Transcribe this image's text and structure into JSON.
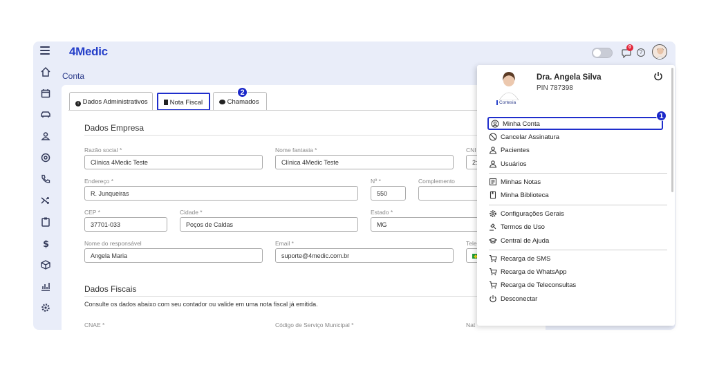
{
  "app": {
    "logo": "4Medic",
    "page_title": "Conta",
    "notification_count": "0"
  },
  "tabs": [
    {
      "label": "Dados Administrativos",
      "icon": "info-circle-icon"
    },
    {
      "label": "Nota Fiscal",
      "icon": "document-icon"
    },
    {
      "label": "Chamados",
      "icon": "chat-bubbles-icon"
    }
  ],
  "steps": {
    "one": "1",
    "two": "2"
  },
  "dados_empresa": {
    "title": "Dados Empresa",
    "razao_social": {
      "label": "Razão social *",
      "value": "Clínica 4Medic Teste"
    },
    "nome_fantasia": {
      "label": "Nome fantasia *",
      "value": "Clínica 4Medic Teste"
    },
    "cnpj": {
      "label": "CNI",
      "value": "2:"
    },
    "endereco": {
      "label": "Endereço *",
      "value": "R. Junqueiras"
    },
    "numero": {
      "label": "Nº *",
      "value": "550"
    },
    "complemento": {
      "label": "Complemento",
      "value": ""
    },
    "cep": {
      "label": "CEP *",
      "value": "37701-033"
    },
    "cidade": {
      "label": "Cidade *",
      "value": "Poços de Caldas"
    },
    "estado": {
      "label": "Estado *",
      "value": "MG"
    },
    "responsavel": {
      "label": "Nome do responsável",
      "value": "Angela Maria"
    },
    "email": {
      "label": "Email *",
      "value": "suporte@4medic.com.br"
    },
    "telefone": {
      "label": "Tele",
      "value": ""
    }
  },
  "dados_fiscais": {
    "title": "Dados Fiscais",
    "subtitle": "Consulte os dados abaixo com seu contador ou valide em uma nota fiscal já emitida.",
    "cnae_label": "CNAE *",
    "codigo_label": "Código de Serviço Municipal *",
    "nat_label": "Nat"
  },
  "user_menu": {
    "name": "Dra. Angela Silva",
    "pin": "PIN 787398",
    "plan": "Cortesia",
    "groups": [
      [
        {
          "label": "Minha Conta",
          "icon": "user-circle-icon"
        },
        {
          "label": "Cancelar Assinatura",
          "icon": "ban-icon"
        },
        {
          "label": "Pacientes",
          "icon": "user-icon"
        },
        {
          "label": "Usuários",
          "icon": "users-icon"
        }
      ],
      [
        {
          "label": "Minhas Notas",
          "icon": "notes-icon"
        },
        {
          "label": "Minha Biblioteca",
          "icon": "book-icon"
        }
      ],
      [
        {
          "label": "Configurações Gerais",
          "icon": "gear-icon"
        },
        {
          "label": "Termos de Uso",
          "icon": "gavel-icon"
        },
        {
          "label": "Central de Ajuda",
          "icon": "graduation-cap-icon"
        }
      ],
      [
        {
          "label": "Recarga de SMS",
          "icon": "cart-icon"
        },
        {
          "label": "Recarga de WhatsApp",
          "icon": "cart-icon"
        },
        {
          "label": "Recarga de Teleconsultas",
          "icon": "cart-icon"
        },
        {
          "label": "Desconectar",
          "icon": "power-icon"
        }
      ]
    ]
  },
  "colors": {
    "accent": "#1f2ecc",
    "brand": "#2640c9",
    "app_bg": "#e9edf9",
    "badge": "#e2263a"
  }
}
